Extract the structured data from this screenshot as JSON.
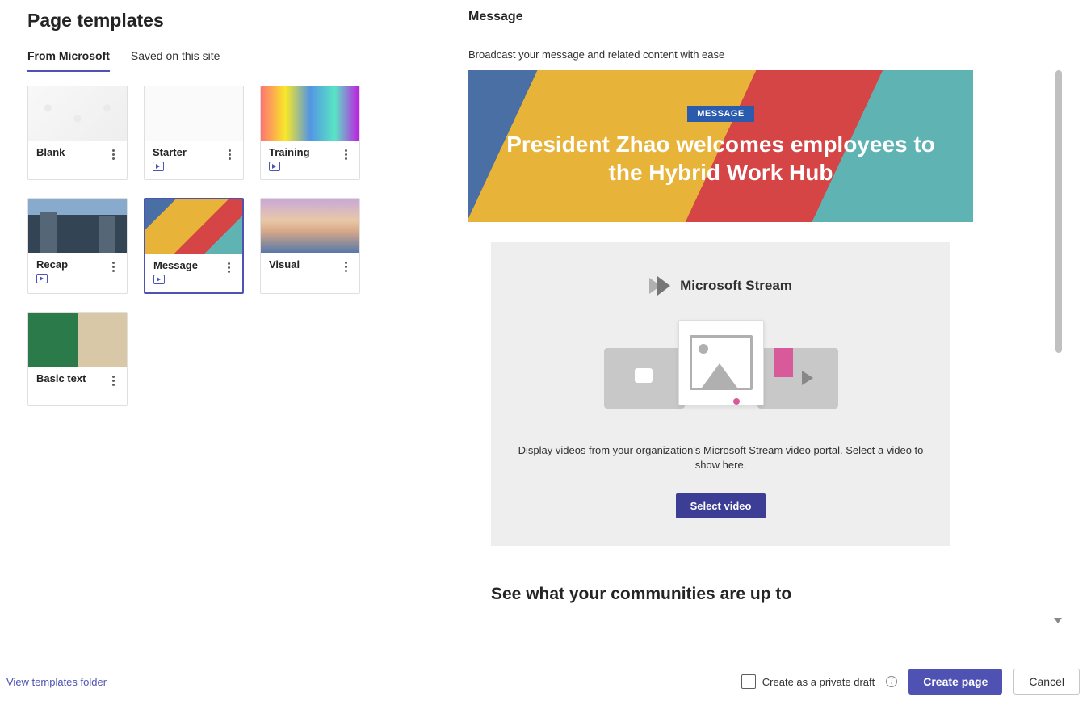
{
  "page_title": "Page templates",
  "tabs": {
    "from_microsoft": "From Microsoft",
    "saved": "Saved on this site"
  },
  "templates": [
    {
      "name": "Blank",
      "has_play": false,
      "thumb": "blank"
    },
    {
      "name": "Starter",
      "has_play": true,
      "thumb": "starter"
    },
    {
      "name": "Training",
      "has_play": true,
      "thumb": "training"
    },
    {
      "name": "Recap",
      "has_play": true,
      "thumb": "recap"
    },
    {
      "name": "Message",
      "has_play": true,
      "thumb": "message",
      "selected": true
    },
    {
      "name": "Visual",
      "has_play": false,
      "thumb": "visual"
    },
    {
      "name": "Basic text",
      "has_play": false,
      "thumb": "basic"
    }
  ],
  "preview": {
    "name": "Message",
    "description": "Broadcast your message and related content with ease",
    "hero_badge": "MESSAGE",
    "hero_title": "President Zhao welcomes employees to the Hybrid Work Hub",
    "stream_label": "Microsoft Stream",
    "stream_desc": "Display videos from your organization's Microsoft Stream video portal. Select a video to show here.",
    "select_video": "Select video",
    "next_section": "See what your communities are up to"
  },
  "footer": {
    "view_templates": "View templates folder",
    "private_draft_label": "Create as a private draft",
    "create_page": "Create page",
    "cancel": "Cancel"
  }
}
